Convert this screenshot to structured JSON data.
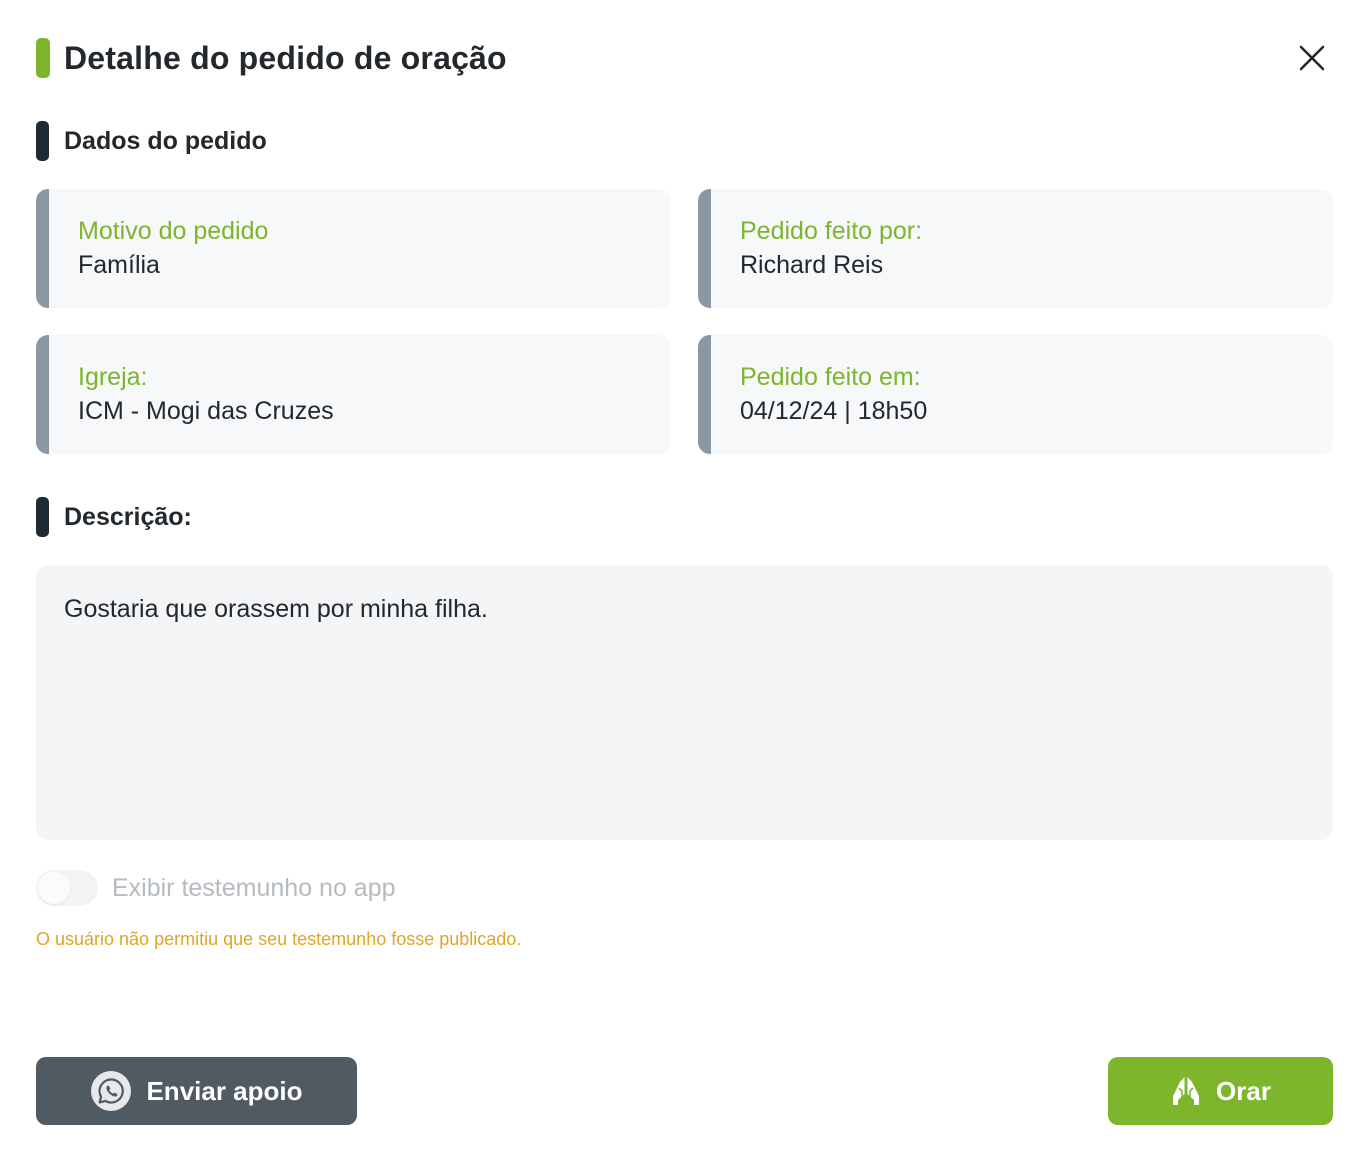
{
  "header": {
    "title": "Detalhe do pedido de oração",
    "accent_color": "#7db52c",
    "close_icon": "close-icon"
  },
  "sections": {
    "dados_title": "Dados do pedido",
    "descricao_title": "Descrição:"
  },
  "cards": {
    "motivo": {
      "label": "Motivo do pedido",
      "value": "Família"
    },
    "feito_por": {
      "label": "Pedido feito por:",
      "value": "Richard Reis"
    },
    "igreja": {
      "label": "Igreja:",
      "value": "ICM - Mogi das Cruzes"
    },
    "feito_em": {
      "label": "Pedido feito em:",
      "value": "04/12/24 | 18h50"
    }
  },
  "description": {
    "text": "Gostaria que orassem por minha filha."
  },
  "testimony": {
    "toggle_label": "Exibir testemunho no app",
    "toggle_state": "off",
    "warning": "O usuário não permitiu que seu testemunho fosse publicado.",
    "warning_color": "#e0a526"
  },
  "actions": {
    "support_label": "Enviar apoio",
    "support_icon": "whatsapp-icon",
    "support_color": "#4f5a62",
    "pray_label": "Orar",
    "pray_icon": "praying-hands-icon",
    "pray_color": "#7db52c"
  }
}
